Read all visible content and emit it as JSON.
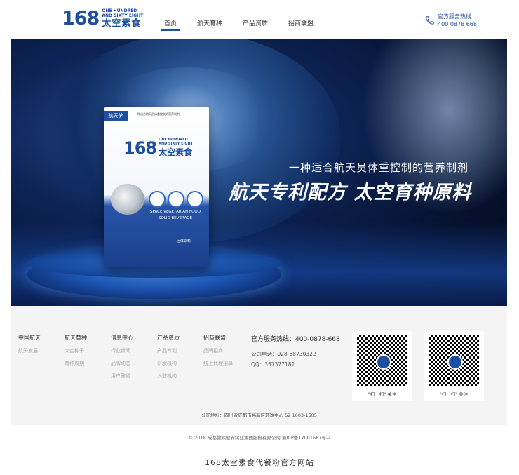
{
  "header": {
    "logo": {
      "number": "168",
      "english": [
        "ONE HUNDRED",
        "AND SIXTY EIGHT"
      ],
      "chinese": "太空素食"
    },
    "nav": [
      "首页",
      "航天育种",
      "产品资质",
      "招商联盟"
    ],
    "active_nav": 0,
    "hotline_label": "官方服务热线",
    "hotline_number": "400 0878 668"
  },
  "banner": {
    "pack_tag": "航天梦",
    "pack_tagline": "一种适合航天员体重控制的营养制剂",
    "pack_logo_number": "168",
    "pack_logo_en": [
      "ONE HUNDRED",
      "AND SIXTY EIGHT"
    ],
    "pack_logo_cn": "太空素食",
    "pack_en_lines": [
      "SPACE VEGETARIAN FOOD",
      "SOLID BEVERAGE"
    ],
    "pack_solid": "固体饮料",
    "headline_small": "一种适合航天员体重控制的营养制剂",
    "headline_big": "航天专利配方 太空育种原料"
  },
  "footer": {
    "columns": [
      {
        "title": "中国航天",
        "items": [
          "航天发展"
        ]
      },
      {
        "title": "航天育种",
        "items": [
          "太空种子",
          "育种周期"
        ]
      },
      {
        "title": "信息中心",
        "items": [
          "行业新闻",
          "品牌动态",
          "用户答疑"
        ]
      },
      {
        "title": "产品资质",
        "items": [
          "产品专利",
          "研发机构",
          "入驻机构"
        ]
      },
      {
        "title": "招商联盟",
        "items": [
          "品牌招商",
          "线上代理招募"
        ]
      }
    ],
    "contact": {
      "hotline": "官方服务热线：400-0878-668",
      "phone": "公司电话：028-68730322",
      "qq": "QQ：357377181"
    },
    "qr_label": "\"扫一扫\" 关注",
    "address": "公司地址：四川省成都市高新区环球中心 S2 1603-1605"
  },
  "copyright": "© 2018 成都德熙健安实业集团股份有限公司  蜀ICP备17001687号-2",
  "caption": "168太空素食代餐粉官方网站",
  "colors": {
    "brand": "#1e4fa0",
    "footer_bg": "#f4f4f4"
  }
}
